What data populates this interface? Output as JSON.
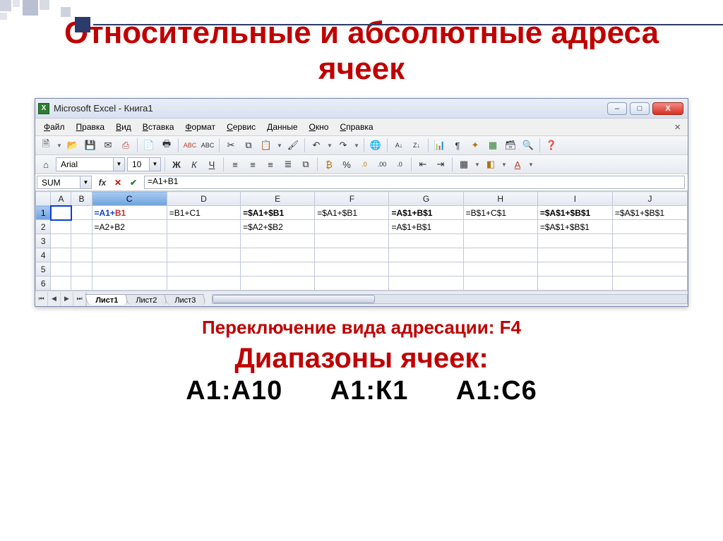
{
  "slide": {
    "title": "Относительные и абсолютные адреса ячеек",
    "caption": "Переключение вида адресации:  F4",
    "subtitle": "Диапазоны ячеек:",
    "ranges": [
      "А1:А10",
      "А1:К1",
      "А1:С6"
    ]
  },
  "window": {
    "title": "Microsoft Excel - Книга1",
    "min_label": "–",
    "max_label": "□",
    "close_label": "X"
  },
  "menu": {
    "items": [
      "Файл",
      "Правка",
      "Вид",
      "Вставка",
      "Формат",
      "Сервис",
      "Данные",
      "Окно",
      "Справка"
    ]
  },
  "font": {
    "name": "Arial",
    "size": "10"
  },
  "formula_bar": {
    "name_box": "SUM",
    "formula": "=A1+B1"
  },
  "columns": [
    "A",
    "B",
    "C",
    "D",
    "E",
    "F",
    "G",
    "H",
    "I",
    "J"
  ],
  "rows": [
    "1",
    "2",
    "3",
    "4",
    "5",
    "6"
  ],
  "cells": {
    "r1": {
      "C_edit_ref1": "=A1+",
      "C_edit_ref2": "B1",
      "D": "=B1+C1",
      "E": "=$A1+$B1",
      "F": "=$A1+$B1",
      "G": "=A$1+B$1",
      "H": "=B$1+C$1",
      "I": "=$A$1+$B$1",
      "J": "=$A$1+$B$1"
    },
    "r2": {
      "C": "=A2+B2",
      "E": "=$A2+$B2",
      "G": "=A$1+B$1",
      "I": "=$A$1+$B$1"
    }
  },
  "tabs": {
    "items": [
      "Лист1",
      "Лист2",
      "Лист3"
    ],
    "active": 0
  }
}
